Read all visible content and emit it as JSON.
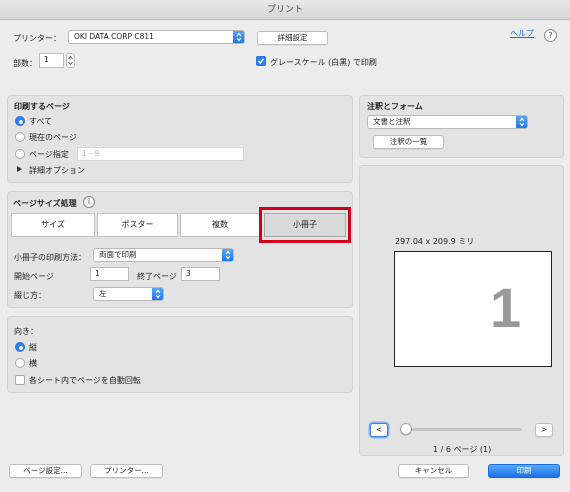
{
  "window": {
    "title": "プリント"
  },
  "printer": {
    "label": "プリンター：",
    "value": "OKI DATA CORP C811",
    "details_button": "詳細設定",
    "help_link": "ヘルプ",
    "help_icon": "?"
  },
  "copies": {
    "label": "部数：",
    "value": "1"
  },
  "grayscale": {
    "label": "グレースケール (白黒) で印刷",
    "checked": true
  },
  "pages": {
    "heading": "印刷するページ",
    "all": "すべて",
    "current": "現在のページ",
    "range": "ページ指定",
    "range_placeholder": "1 - 9",
    "more_options": "詳細オプション"
  },
  "page_sizing": {
    "heading": "ページサイズ処理",
    "info_icon": "i",
    "tabs": [
      "サイズ",
      "ポスター",
      "複数",
      "小冊子"
    ],
    "selected": "小冊子",
    "booklet_subset_label": "小冊子の印刷方法：",
    "booklet_subset_value": "両面で印刷",
    "start_label": "開始ページ",
    "start_value": "1",
    "end_label": "終了ページ",
    "end_value": "3",
    "binding_label": "綴じ方：",
    "binding_value": "左"
  },
  "orientation": {
    "heading": "向き：",
    "portrait": "縦",
    "landscape": "横",
    "auto_rotate": "各シート内でページを自動回転"
  },
  "comments": {
    "heading": "注釈とフォーム",
    "value": "文書と注釈",
    "summarize_button": "注釈の一覧"
  },
  "preview": {
    "size": "297.04 x 209.9 ミリ",
    "page_number_glyph": "1",
    "prev": "<",
    "next": ">",
    "page_counter": "1 / 6 ページ (1)",
    "slider_fraction": 0
  },
  "footer": {
    "page_setup": "ページ設定...",
    "printer": "プリンター...",
    "cancel": "キャンセル",
    "print": "印刷"
  },
  "colors": {
    "accent": "#1a73e8",
    "highlight": "#d0021b"
  }
}
